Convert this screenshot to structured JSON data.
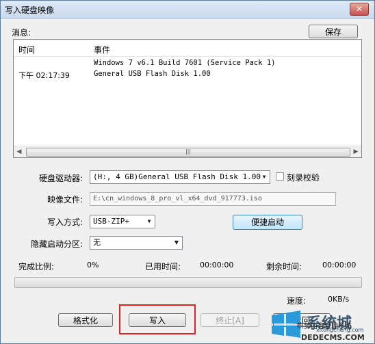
{
  "window": {
    "title": "写入硬盘映像",
    "close_glyph": "✕"
  },
  "messages": {
    "label": "消息:",
    "save_button": "保存",
    "columns": {
      "time": "时间",
      "event": "事件"
    },
    "rows": [
      {
        "time": "",
        "event": "Windows 7 v6.1 Build 7601 (Service Pack 1)"
      },
      {
        "time": "下午 02:17:39",
        "event": "General USB Flash Disk  1.00"
      }
    ]
  },
  "drive": {
    "label": "硬盘驱动器:",
    "value": "(H:, 4 GB)General USB Flash Disk  1.00",
    "verify_label": "刻录校验",
    "verify_checked": false
  },
  "image_file": {
    "label": "映像文件:",
    "value": "E:\\cn_windows_8_pro_vl_x64_dvd_917773.iso"
  },
  "write_mode": {
    "label": "写入方式:",
    "value": "USB-ZIP+",
    "quick_boot_button": "便捷启动"
  },
  "hidden_partition": {
    "label": "隐藏启动分区:",
    "value": "无"
  },
  "stats": {
    "completion_label": "完成比例:",
    "completion_value": "0%",
    "elapsed_label": "已用时间:",
    "elapsed_value": "00:00:00",
    "remaining_label": "剩余时间:",
    "remaining_value": "00:00:00",
    "speed_label": "速度:",
    "speed_value": "0KB/s",
    "progress_fraction": 0
  },
  "buttons": {
    "format": "格式化",
    "write": "写入",
    "stop": "终止[A]",
    "back": "返回"
  },
  "watermark": {
    "brand": "系统城",
    "site": "xitongcheng.com",
    "caption": "织梦内容管理系统",
    "domain_text": "DEDECMS.COM"
  }
}
